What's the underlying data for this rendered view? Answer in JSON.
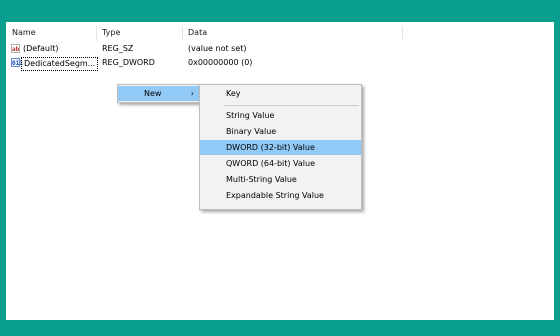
{
  "columns": {
    "name": "Name",
    "type": "Type",
    "data": "Data"
  },
  "rows": [
    {
      "icon": "string-value-icon",
      "icon_glyph": "ab",
      "name": "(Default)",
      "type": "REG_SZ",
      "data": "(value not set)"
    },
    {
      "icon": "dword-value-icon",
      "icon_glyph": "011",
      "name": "DedicatedSegm...",
      "type": "REG_DWORD",
      "data": "0x00000000 (0)"
    }
  ],
  "context_menu": {
    "new_label": "New",
    "new_arrow": "›"
  },
  "submenu": {
    "items": [
      "Key",
      "String Value",
      "Binary Value",
      "DWORD (32-bit) Value",
      "QWORD (64-bit) Value",
      "Multi-String Value",
      "Expandable String Value"
    ],
    "highlighted": "DWORD (32-bit) Value"
  },
  "colors": {
    "frame": "#0a9e8f",
    "highlight": "#91c9f7",
    "menu_bg": "#f2f2f2"
  }
}
